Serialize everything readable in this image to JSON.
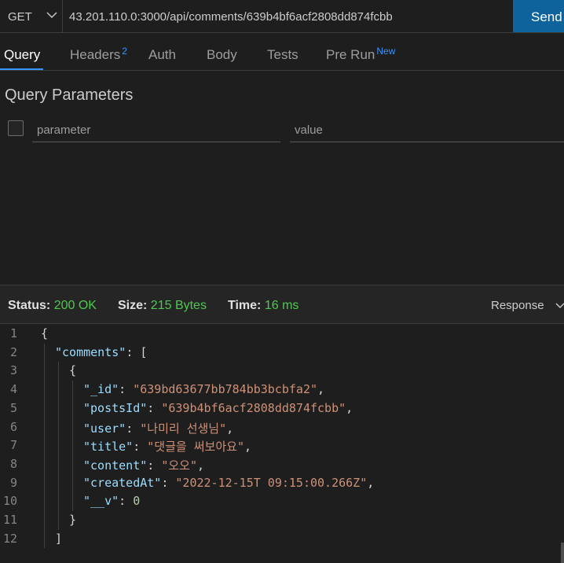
{
  "request": {
    "method": "GET",
    "url": "43.201.110.0:3000/api/comments/639b4bf6acf2808dd874fcbb",
    "send_label": "Send"
  },
  "tabs": [
    {
      "label": "Query",
      "active": true
    },
    {
      "label": "Headers",
      "badge": "2"
    },
    {
      "label": "Auth"
    },
    {
      "label": "Body"
    },
    {
      "label": "Tests"
    },
    {
      "label": "Pre Run",
      "badge": "New"
    }
  ],
  "query": {
    "title": "Query Parameters",
    "param_placeholder": "parameter",
    "value_placeholder": "value"
  },
  "status": {
    "status_key": "Status:",
    "status_value": "200 OK",
    "size_key": "Size:",
    "size_value": "215 Bytes",
    "time_key": "Time:",
    "time_value": "16 ms",
    "view_label": "Response",
    "value_color": "#4ec950"
  },
  "response_body": {
    "line_numbers": [
      "1",
      "2",
      "3",
      "4",
      "5",
      "6",
      "7",
      "8",
      "9",
      "10",
      "11",
      "12"
    ],
    "lines": [
      "{",
      "\"comments\": [",
      "{",
      "\"_id\": \"639bd63677bb784bb3bcbfa2\",",
      "\"postsId\": \"639b4bf6acf2808dd874fcbb\",",
      "\"user\": \"나미리 선생님\",",
      "\"title\": \"댓글을 써보아요\",",
      "\"content\": \"오오\",",
      "\"createdAt\": \"2022-12-15T 09:15:00.266Z\",",
      "\"__v\": 0",
      "}",
      "]"
    ]
  }
}
